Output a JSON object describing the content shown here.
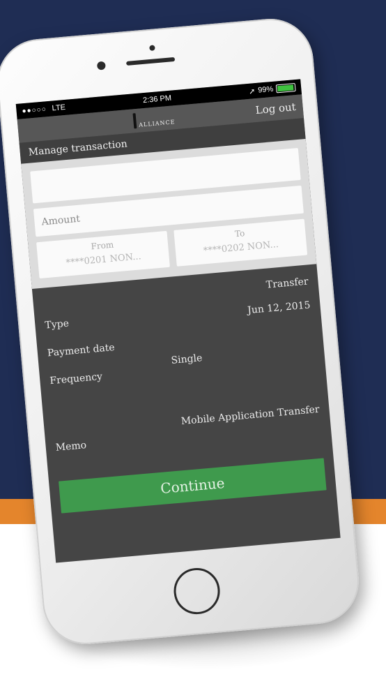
{
  "status": {
    "carrier": "LTE",
    "signal": "●●○○○",
    "time": "2:36 PM",
    "battery": "99%",
    "location": "➚"
  },
  "nav": {
    "logo_text": "ALLIANCE",
    "logout_label": "Log out"
  },
  "page": {
    "title": "Manage transaction"
  },
  "form": {
    "top_hint": "",
    "amount_placeholder": "Amount",
    "from": {
      "label": "From",
      "value": "****0201 NON..."
    },
    "to": {
      "label": "To",
      "value": "****0202 NON..."
    }
  },
  "details": {
    "type_label": "Type",
    "type_value": "Transfer",
    "payment_date_label": "Payment date",
    "payment_date_value": "Jun 12, 2015",
    "frequency_label": "Frequency",
    "frequency_value": "Single",
    "memo_label": "Memo",
    "memo_value": "Mobile Application Transfer"
  },
  "actions": {
    "continue_label": "Continue"
  },
  "colors": {
    "background_navy": "#1f2d54",
    "accent_orange": "#e4852c",
    "continue_green": "#3f9a4d",
    "screen_dark": "#454545"
  }
}
